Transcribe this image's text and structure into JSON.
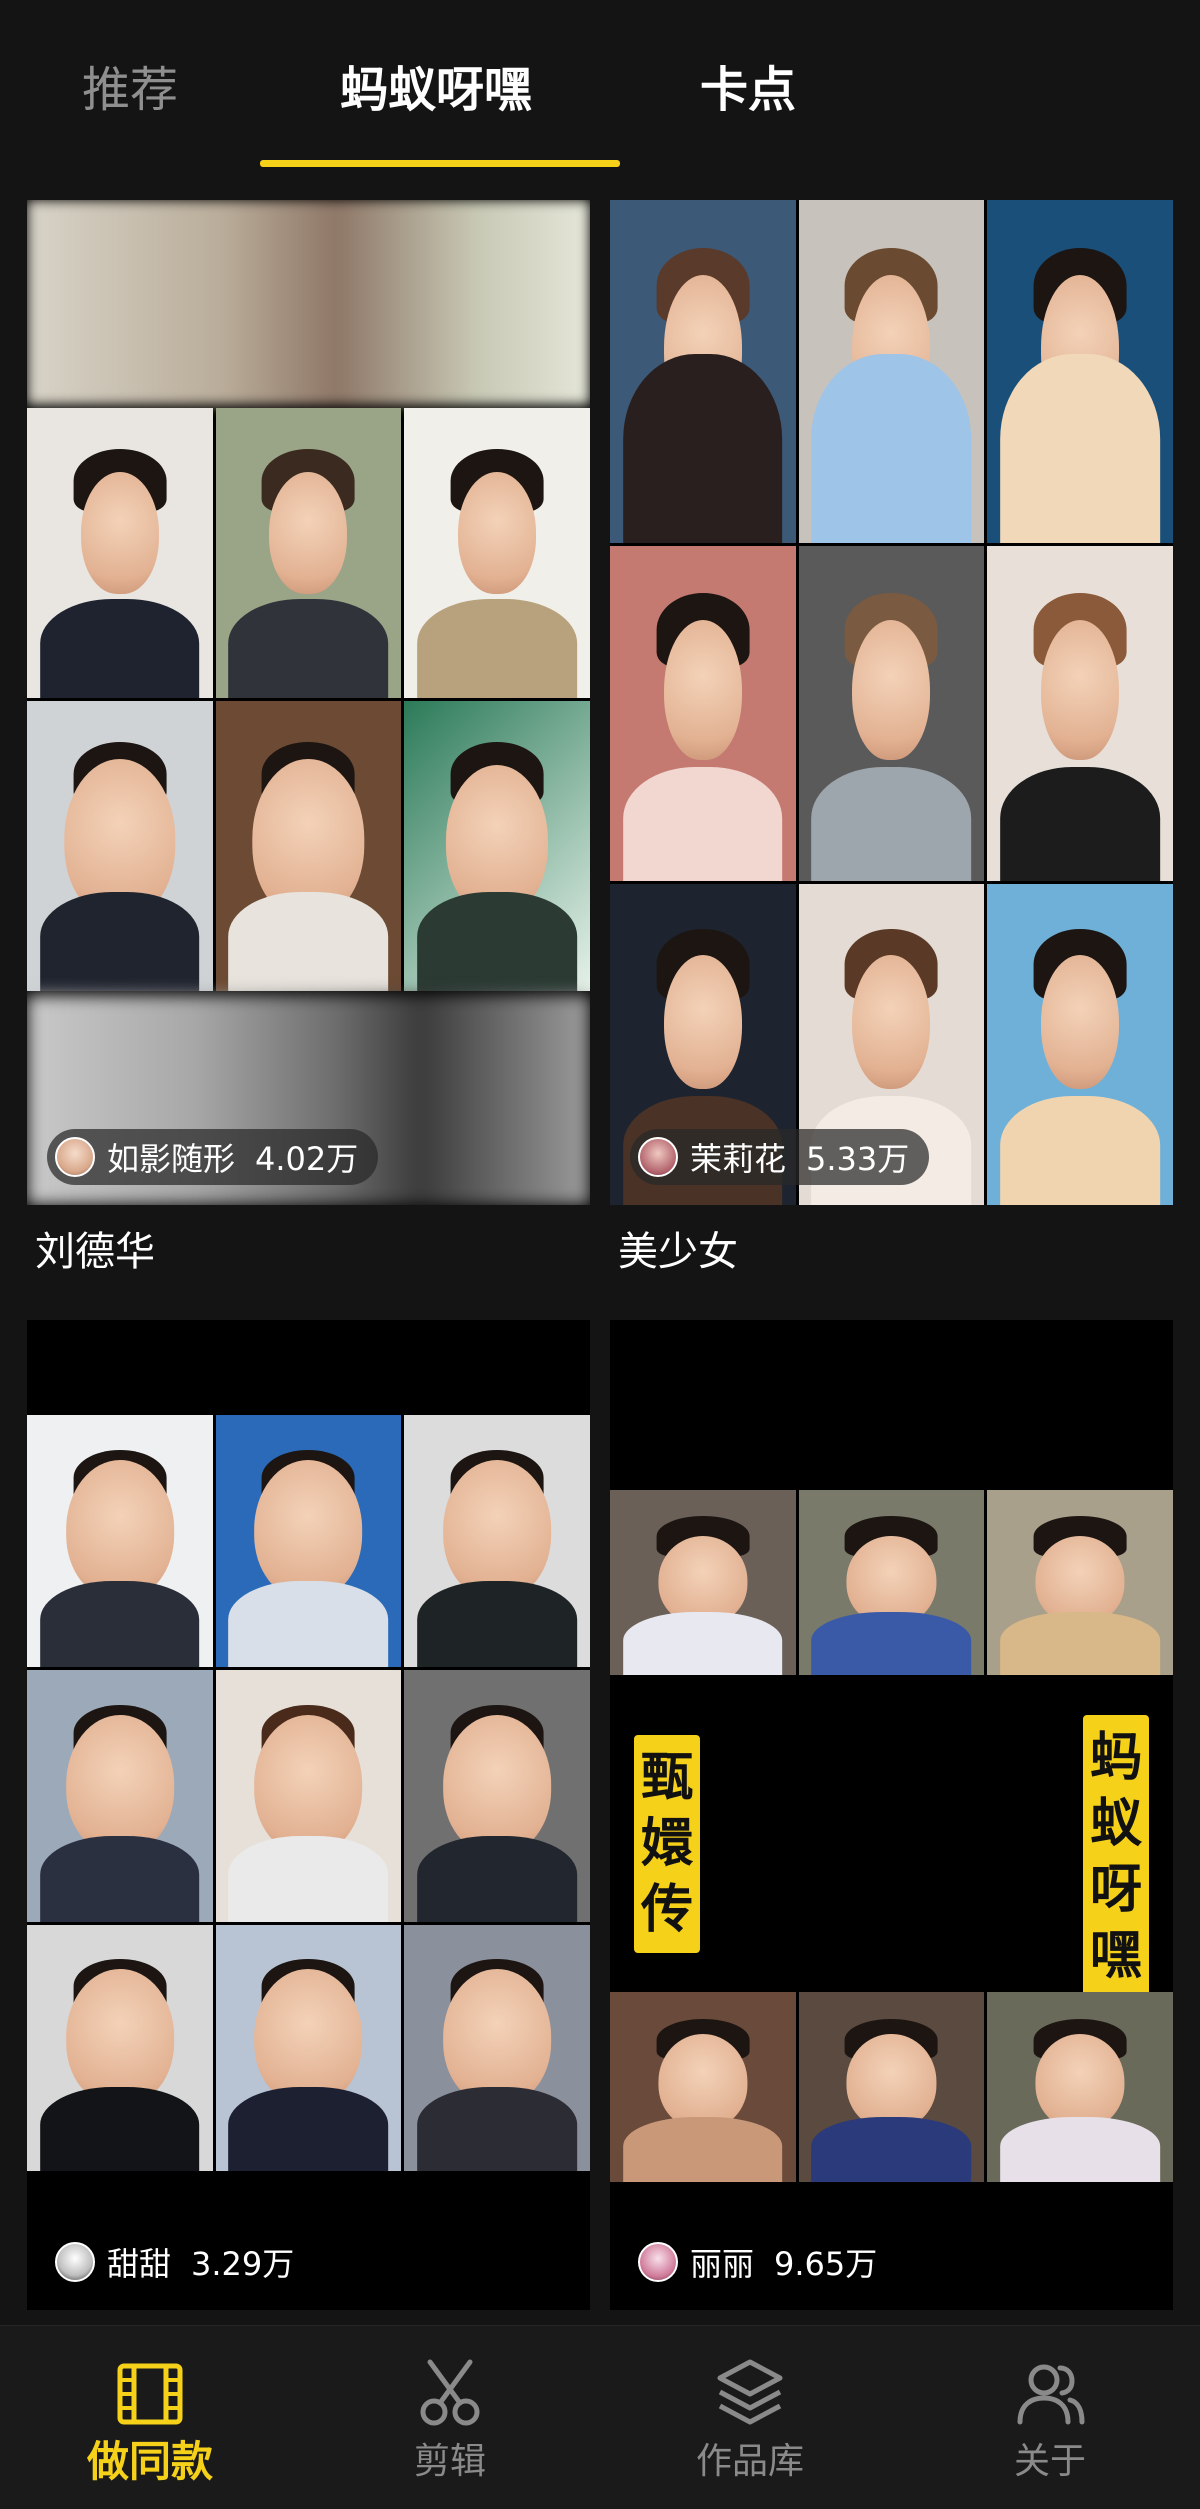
{
  "tabs": [
    {
      "label": "推荐",
      "active": false
    },
    {
      "label": "蚂蚁呀嘿",
      "active": true
    },
    {
      "label": "卡点",
      "active": false
    }
  ],
  "cards": [
    {
      "title": "刘德华",
      "author": "如影随形",
      "count": "4.02万"
    },
    {
      "title": "美少女",
      "author": "茉莉花",
      "count": "5.33万"
    },
    {
      "title": "",
      "author": "甜甜",
      "count": "3.29万"
    },
    {
      "title": "",
      "author": "丽丽",
      "count": "9.65万",
      "tag_left": "甄嬛传",
      "tag_right": "蚂蚁呀嘿"
    }
  ],
  "bottom_nav": [
    {
      "label": "做同款",
      "icon": "film-icon",
      "active": true
    },
    {
      "label": "剪辑",
      "icon": "scissors-icon",
      "active": false
    },
    {
      "label": "作品库",
      "icon": "layers-icon",
      "active": false
    },
    {
      "label": "关于",
      "icon": "users-icon",
      "active": false
    }
  ],
  "colors": {
    "accent": "#f6d11a",
    "background": "#141414",
    "inactive": "#8a8a8a"
  }
}
